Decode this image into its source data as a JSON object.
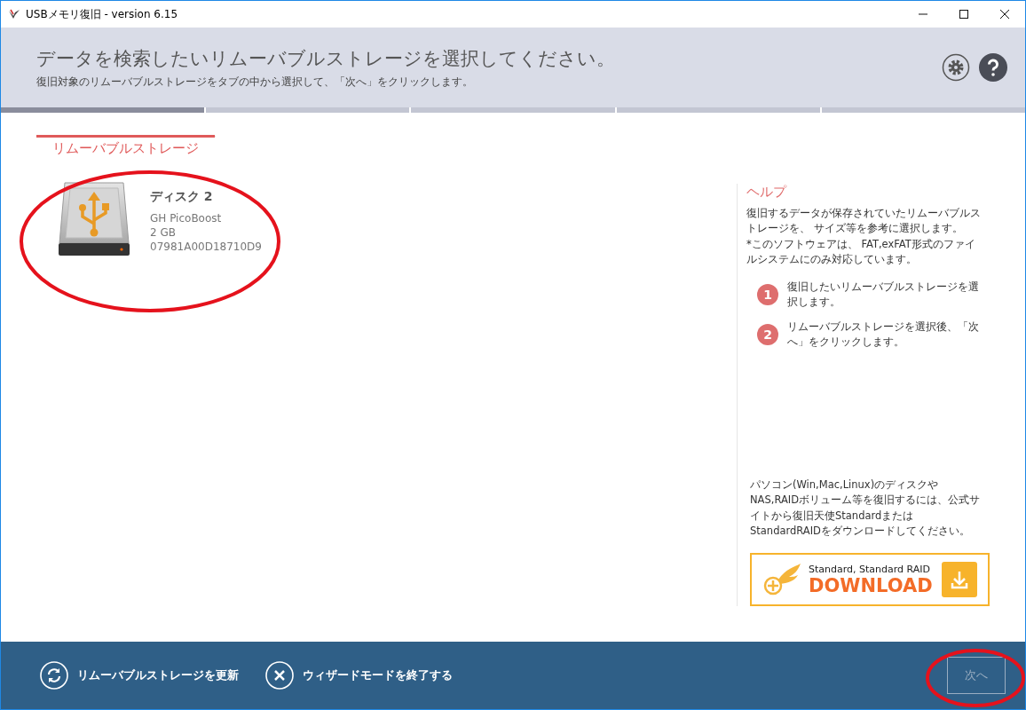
{
  "window": {
    "title": "USBメモリ復旧 - version 6.15"
  },
  "header": {
    "title": "データを検索したいリムーバブルストレージを選択してください。",
    "subtitle": "復旧対象のリムーバブルストレージをタブの中から選択して、「次へ」をクリックします。"
  },
  "steps": [
    {
      "selected": true
    },
    {
      "selected": false
    },
    {
      "selected": false
    },
    {
      "selected": false
    },
    {
      "selected": false
    }
  ],
  "tabs": [
    {
      "label": "リムーバブルストレージ",
      "selected": true
    }
  ],
  "devices": [
    {
      "name": "ディスク 2",
      "model": "GH PicoBoost",
      "size": "2 GB",
      "serial": "07981A00D18710D9",
      "selected": false
    }
  ],
  "help": {
    "title": "ヘルプ",
    "description": "復旧するデータが保存されていたリムーバブルストレージを、 サイズ等を参考に選択します。\n*このソフトウェアは、 FAT,exFAT形式のファイルシステムにのみ対応しています。",
    "steps": [
      {
        "number": "1",
        "text": "復旧したいリムーバブルストレージを選択します。"
      },
      {
        "number": "2",
        "text": "リムーバブルストレージを選択後、「次へ」をクリックします。"
      }
    ],
    "promo": "パソコン(Win,Mac,Linux)のディスクやNAS,RAIDボリューム等を復旧するには、公式サイトから復旧天使StandardまたはStandardRAIDをダウンロードしてください。",
    "download": {
      "caption": "Standard, Standard RAID",
      "label": "DOWNLOAD"
    }
  },
  "footer": {
    "refresh": "リムーバブルストレージを更新",
    "exit": "ウィザードモードを終了する",
    "next": {
      "label": "次へ",
      "disabled": true
    }
  }
}
